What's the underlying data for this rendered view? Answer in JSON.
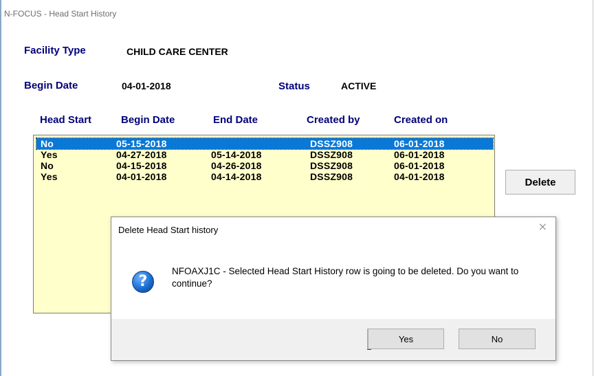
{
  "window": {
    "title": "N-FOCUS - Head Start History"
  },
  "facility": {
    "type_label": "Facility Type",
    "type_value": "CHILD CARE CENTER",
    "begin_label": "Begin Date",
    "begin_value": "04-01-2018",
    "status_label": "Status",
    "status_value": "ACTIVE"
  },
  "table": {
    "headers": [
      "Head Start",
      "Begin Date",
      "End Date",
      "Created by",
      "Created on"
    ],
    "rows": [
      {
        "head_start": "No",
        "begin": "05-15-2018",
        "end": "",
        "created_by": "DSSZ908",
        "created_on": "06-01-2018",
        "selected": true
      },
      {
        "head_start": "Yes",
        "begin": "04-27-2018",
        "end": "05-14-2018",
        "created_by": "DSSZ908",
        "created_on": "06-01-2018"
      },
      {
        "head_start": "No",
        "begin": "04-15-2018",
        "end": "04-26-2018",
        "created_by": "DSSZ908",
        "created_on": "06-01-2018"
      },
      {
        "head_start": "Yes",
        "begin": "04-01-2018",
        "end": "04-14-2018",
        "created_by": "DSSZ908",
        "created_on": "04-01-2018"
      }
    ]
  },
  "buttons": {
    "delete": "Delete"
  },
  "dialog": {
    "title": "Delete Head Start history",
    "close_glyph": "×",
    "icon": "question-icon",
    "message": "NFOAXJ1C - Selected Head Start History row is going to be deleted. Do you want to continue?",
    "yes": "Yes",
    "no": "No"
  },
  "colors": {
    "label_navy": "#00007a",
    "grid_bg": "#ffffcc",
    "selection": "#0a78d7"
  }
}
